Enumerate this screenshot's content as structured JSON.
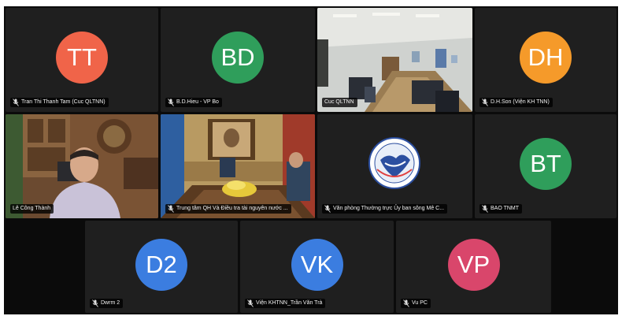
{
  "participants": [
    {
      "initials": "TT",
      "name": "Tran Thi Thanh Tam (Cuc QLTNN)",
      "color": "#f06449",
      "muted": true
    },
    {
      "initials": "BD",
      "name": "B.D.Hieu - VP Bo",
      "color": "#2f9e5b",
      "muted": true
    },
    {
      "initials": "",
      "name": "Cuc QLTNN",
      "color": "",
      "muted": false
    },
    {
      "initials": "DH",
      "name": "D.H.Son (Viện KH TNN)",
      "color": "#f59a2a",
      "muted": true
    },
    {
      "initials": "",
      "name": "Lê Công Thành",
      "color": "",
      "muted": false
    },
    {
      "initials": "",
      "name": "Trung tâm QH Và Điều tra tài nguyên nước ...",
      "color": "",
      "muted": true
    },
    {
      "initials": "",
      "name": "Văn phòng Thường trực Ủy ban sông Mê C...",
      "color": "",
      "muted": true
    },
    {
      "initials": "BT",
      "name": "BAO TNMT",
      "color": "#2f9e5b",
      "muted": true
    },
    {
      "initials": "D2",
      "name": "Dwrm 2",
      "color": "#3b7de0",
      "muted": true
    },
    {
      "initials": "VK",
      "name": "Viện KHTNN_Trần Văn Trà",
      "color": "#3b7de0",
      "muted": true
    },
    {
      "initials": "VP",
      "name": "Vu PC",
      "color": "#d9466b",
      "muted": true
    }
  ]
}
